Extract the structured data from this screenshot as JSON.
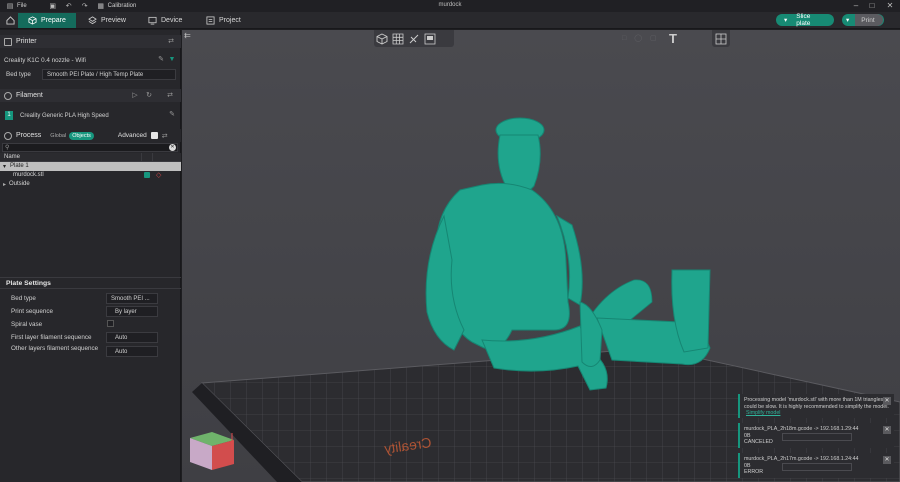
{
  "window": {
    "title": "murdock",
    "menu_file": "File",
    "menu_calibration": "Calibration"
  },
  "tabs": [
    {
      "label": "Prepare",
      "icon": "cube-icon",
      "active": true
    },
    {
      "label": "Preview",
      "icon": "layers-icon",
      "active": false
    },
    {
      "label": "Device",
      "icon": "monitor-icon",
      "active": false
    },
    {
      "label": "Project",
      "icon": "project-icon",
      "active": false
    }
  ],
  "actions": {
    "slice": "Slice plate",
    "print": "Print"
  },
  "printer": {
    "header": "Printer",
    "name": "Creality K1C 0.4 nozzle - Wifi",
    "bed_type_label": "Bed type",
    "bed_type_value": "Smooth PEI Plate / High Temp Plate"
  },
  "filament": {
    "header": "Filament",
    "slot": "1",
    "name": "Creality Generic PLA High Speed"
  },
  "process": {
    "header": "Process",
    "toggle_global": "Global",
    "toggle_objects": "Objects",
    "advanced_label": "Advanced"
  },
  "object_list": {
    "col_name": "Name",
    "plate": "Plate 1",
    "object": "murdock.stl",
    "outside": "Outside"
  },
  "plate_settings": {
    "header": "Plate Settings",
    "rows": [
      {
        "label": "Bed type",
        "value": "Smooth PEI ..."
      },
      {
        "label": "Print sequence",
        "value": "By layer"
      },
      {
        "label": "Spiral vase",
        "value": ""
      },
      {
        "label": "First layer filament sequence",
        "value": "Auto"
      },
      {
        "label": "Other layers filament sequence",
        "value": "Auto"
      }
    ]
  },
  "notifications": [
    {
      "text": "Processing model 'murdock.stl' with more than 1M triangles could be slow. It is highly recommended to simplify the model.",
      "link": "Simplify model"
    },
    {
      "text": "murdock_PLA_2h18m.gcode -> 192.168.1.29:44",
      "unit": "0B",
      "status": "CANCELED"
    },
    {
      "text": "murdock_PLA_2h17m.gcode -> 192.168.1.24:44",
      "unit": "0B",
      "status": "ERROR"
    }
  ],
  "plate_label": "Creality",
  "colors": {
    "accent": "#178a74",
    "model": "#1fa58d",
    "bed": "#2c2c30",
    "viewport_bg": "#47474c"
  }
}
